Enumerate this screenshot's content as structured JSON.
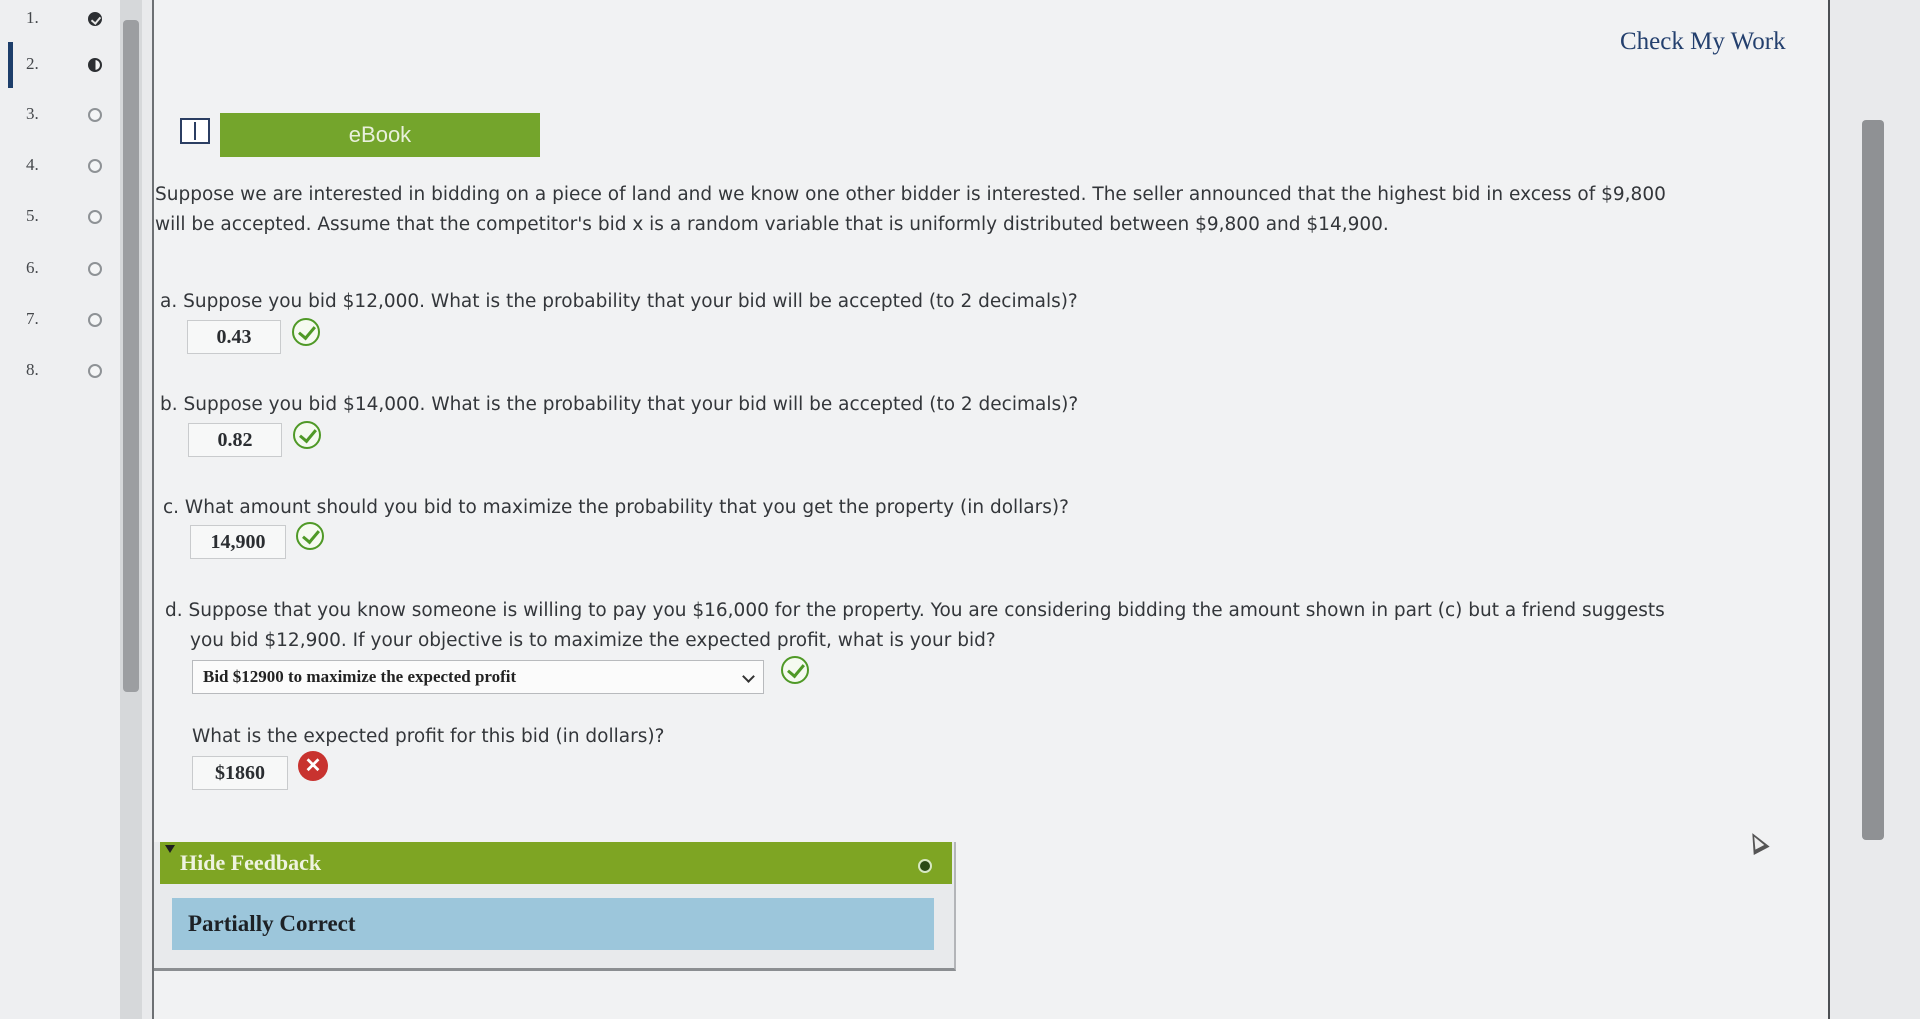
{
  "nav": {
    "items": [
      {
        "num": "1.",
        "status": "done"
      },
      {
        "num": "2.",
        "status": "partial"
      },
      {
        "num": "3.",
        "status": "open"
      },
      {
        "num": "4.",
        "status": "open"
      },
      {
        "num": "5.",
        "status": "open"
      },
      {
        "num": "6.",
        "status": "open"
      },
      {
        "num": "7.",
        "status": "open"
      },
      {
        "num": "8.",
        "status": "open"
      }
    ],
    "active": "2."
  },
  "header": {
    "check_my_work": "Check My Work",
    "ebook": "eBook"
  },
  "problem": {
    "intro_line1": "Suppose we are interested in bidding on a piece of land and we know one other bidder is interested. The seller announced that the highest bid in excess of $9,800",
    "intro_line2": "will be accepted. Assume that the competitor's bid x is a random variable that is uniformly distributed between $9,800 and $14,900.",
    "a_question": "a. Suppose you bid $12,000. What is the probability that your bid will be accepted (to 2 decimals)?",
    "a_answer": "0.43",
    "b_question": "b. Suppose you bid $14,000. What is the probability that your bid will be accepted (to 2 decimals)?",
    "b_answer": "0.82",
    "c_question": "c. What amount should you bid to maximize the probability that you get the property (in dollars)?",
    "c_answer": "14,900",
    "d_question_line1": "d. Suppose that you know someone is willing to pay you $16,000 for the property. You are considering bidding the amount shown in part (c) but a friend suggests",
    "d_question_line2": "you bid $12,900. If your objective is to maximize the expected profit, what is your bid?",
    "d_select_value": "Bid $12900 to maximize the expected profit",
    "d_profit_question": "What is the expected profit for this bid (in dollars)?",
    "d_profit_answer": "$1860",
    "wrong_mark": "✕"
  },
  "feedback": {
    "toggle_label": "Hide Feedback",
    "result": "Partially Correct"
  },
  "colors": {
    "accent_green": "#74a52c",
    "correct": "#4f9926",
    "incorrect": "#c8332f",
    "feedback_result_bg": "#9cc6db",
    "link": "#24406e"
  }
}
